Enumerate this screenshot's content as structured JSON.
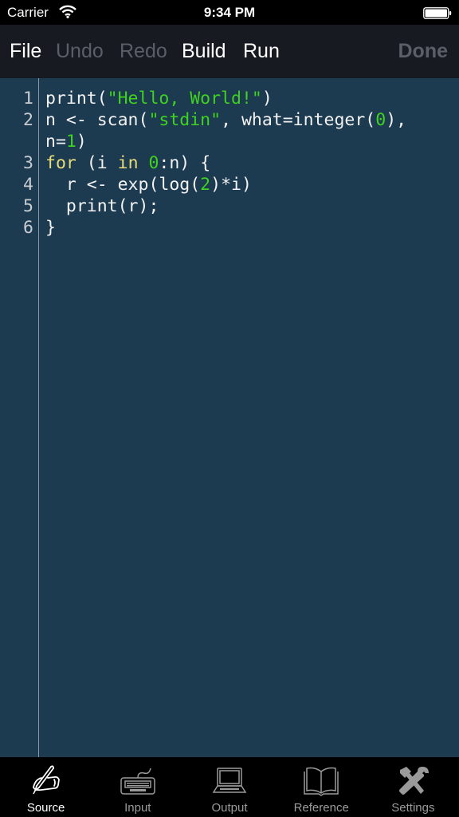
{
  "status_bar": {
    "carrier": "Carrier",
    "time": "9:34 PM",
    "icons": [
      "wifi-icon",
      "battery-icon"
    ]
  },
  "toolbar": {
    "file_label": "File",
    "undo_label": "Undo",
    "redo_label": "Redo",
    "build_label": "Build",
    "run_label": "Run",
    "done_label": "Done",
    "undo_enabled": false,
    "redo_enabled": false,
    "done_enabled": false
  },
  "editor": {
    "language": "R",
    "colors": {
      "background": "#1c3a50",
      "string": "#3fd21e",
      "number": "#3fd21e",
      "keyword": "#e8dc78",
      "text": "#f2f2f2"
    },
    "lines": [
      {
        "number": "1",
        "tokens": [
          {
            "t": "print(",
            "c": "plain"
          },
          {
            "t": "\"Hello, World!\"",
            "c": "str"
          },
          {
            "t": ")",
            "c": "plain"
          }
        ]
      },
      {
        "number": "2",
        "tokens": [
          {
            "t": "n <- scan(",
            "c": "plain"
          },
          {
            "t": "\"stdin\"",
            "c": "str"
          },
          {
            "t": ", what=integer(",
            "c": "plain"
          },
          {
            "t": "0",
            "c": "num"
          },
          {
            "t": "),",
            "c": "plain"
          }
        ]
      },
      {
        "number": "",
        "tokens": [
          {
            "t": "n=",
            "c": "plain"
          },
          {
            "t": "1",
            "c": "num"
          },
          {
            "t": ")",
            "c": "plain"
          }
        ]
      },
      {
        "number": "3",
        "tokens": [
          {
            "t": "for",
            "c": "kw"
          },
          {
            "t": " (i ",
            "c": "plain"
          },
          {
            "t": "in",
            "c": "kw"
          },
          {
            "t": " ",
            "c": "plain"
          },
          {
            "t": "0",
            "c": "num"
          },
          {
            "t": ":n) {",
            "c": "plain"
          }
        ]
      },
      {
        "number": "4",
        "tokens": [
          {
            "t": "  r <- exp(log(",
            "c": "plain"
          },
          {
            "t": "2",
            "c": "num"
          },
          {
            "t": ")*i)",
            "c": "plain"
          }
        ]
      },
      {
        "number": "5",
        "tokens": [
          {
            "t": "  print(r);",
            "c": "plain"
          }
        ]
      },
      {
        "number": "6",
        "tokens": [
          {
            "t": "}",
            "c": "plain"
          }
        ]
      }
    ]
  },
  "tab_bar": {
    "active": "source",
    "tabs": [
      {
        "id": "source",
        "label": "Source",
        "icon": "hand-writing-icon"
      },
      {
        "id": "input",
        "label": "Input",
        "icon": "keyboard-icon"
      },
      {
        "id": "output",
        "label": "Output",
        "icon": "laptop-icon"
      },
      {
        "id": "reference",
        "label": "Reference",
        "icon": "book-icon"
      },
      {
        "id": "settings",
        "label": "Settings",
        "icon": "tools-icon"
      }
    ]
  }
}
